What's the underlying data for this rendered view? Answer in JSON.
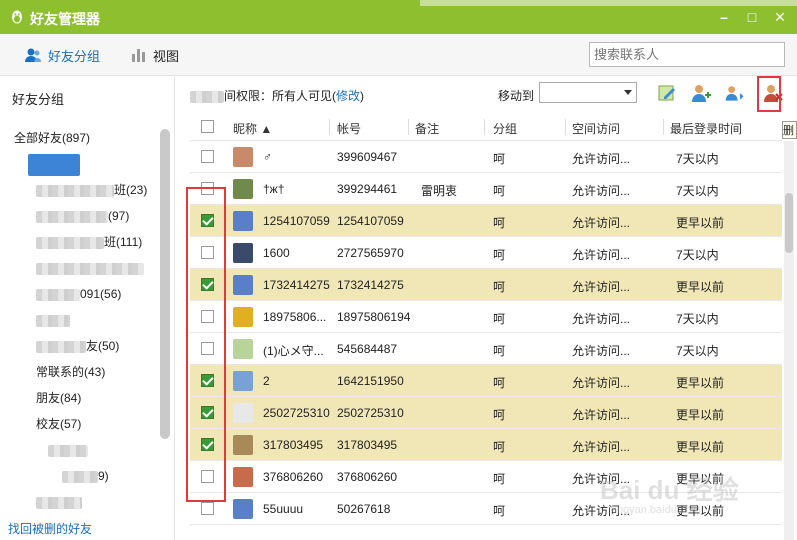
{
  "window": {
    "title": "好友管理器",
    "minimize": "–",
    "maximize": "□",
    "close": "✕"
  },
  "toolbar": {
    "friend_group_label": "好友分组",
    "view_label": "视图",
    "search_placeholder": "搜索联系人"
  },
  "sidebar": {
    "header": "好友分组",
    "all_friends": "全部好友(897)",
    "groups": [
      {
        "label": "",
        "blurred": true,
        "selected": true
      },
      {
        "label": "班(23)",
        "blurred": true
      },
      {
        "label": "(97)",
        "blurred": true
      },
      {
        "label": "班(111)",
        "blurred": true
      },
      {
        "label": "",
        "blurred": true
      },
      {
        "label": "091(56)",
        "blurred": true
      },
      {
        "label": "",
        "blurred": true
      },
      {
        "label": "友(50)",
        "blurred": true
      },
      {
        "label": "常联系的(43)",
        "blurred": false
      },
      {
        "label": "朋友(84)",
        "blurred": false
      },
      {
        "label": "校友(57)",
        "blurred": false
      },
      {
        "label": "",
        "blurred": true
      },
      {
        "label": "9)",
        "blurred": true
      },
      {
        "label": "",
        "blurred": true
      }
    ],
    "recover_link": "找回被删的好友"
  },
  "main": {
    "permission_label": "间权限：所有人可见(",
    "permission_link": "修改",
    "permission_close": ")",
    "move_to_label": "移动到",
    "tooltip": "删"
  },
  "table": {
    "headers": [
      "昵称 ▲",
      "帐号",
      "备注",
      "分组",
      "空间访问",
      "最后登录时间"
    ],
    "rows": [
      {
        "nickname": "♂",
        "account": "399609467",
        "note": "",
        "group": "呵",
        "access": "允许访问...",
        "last_login": "7天以内",
        "checked": false,
        "avatar": "#c98a6a"
      },
      {
        "nickname": "†ж†",
        "account": "399294461",
        "note": "雷明衷",
        "group": "呵",
        "access": "允许访问...",
        "last_login": "7天以内",
        "checked": false,
        "avatar": "#6f8a4a"
      },
      {
        "nickname": "1254107059",
        "account": "1254107059",
        "note": "",
        "group": "呵",
        "access": "允许访问...",
        "last_login": "更早以前",
        "checked": true,
        "avatar": "#5a7fc9"
      },
      {
        "nickname": "1600",
        "account": "2727565970",
        "note": "",
        "group": "呵",
        "access": "允许访问...",
        "last_login": "7天以内",
        "checked": false,
        "avatar": "#3a4a6a"
      },
      {
        "nickname": "1732414275",
        "account": "1732414275",
        "note": "",
        "group": "呵",
        "access": "允许访问...",
        "last_login": "更早以前",
        "checked": true,
        "avatar": "#5a7fc9"
      },
      {
        "nickname": "18975806...",
        "account": "18975806194",
        "note": "",
        "group": "呵",
        "access": "允许访问...",
        "last_login": "7天以内",
        "checked": false,
        "avatar": "#e0b020"
      },
      {
        "nickname": "(1)心メ守...",
        "account": "545684487",
        "note": "",
        "group": "呵",
        "access": "允许访问...",
        "last_login": "7天以内",
        "checked": false,
        "avatar": "#b8d49a"
      },
      {
        "nickname": "2",
        "account": "1642151950",
        "note": "",
        "group": "呵",
        "access": "允许访问...",
        "last_login": "更早以前",
        "checked": true,
        "avatar": "#7aa0d8"
      },
      {
        "nickname": "2502725310",
        "account": "2502725310",
        "note": "",
        "group": "呵",
        "access": "允许访问...",
        "last_login": "更早以前",
        "checked": true,
        "avatar": "#e8e8e8"
      },
      {
        "nickname": "317803495",
        "account": "317803495",
        "note": "",
        "group": "呵",
        "access": "允许访问...",
        "last_login": "更早以前",
        "checked": true,
        "avatar": "#a88a5a"
      },
      {
        "nickname": "376806260",
        "account": "376806260",
        "note": "",
        "group": "呵",
        "access": "允许访问...",
        "last_login": "更早以前",
        "checked": false,
        "avatar": "#c96a4a"
      },
      {
        "nickname": "55uuuu",
        "account": "50267618",
        "note": "",
        "group": "呵",
        "access": "允许访问...",
        "last_login": "更早以前",
        "checked": false,
        "avatar": "#5a7fc9"
      }
    ]
  },
  "watermark": {
    "main": "Bai du 经验",
    "sub": "jingyan.baidu.com"
  }
}
